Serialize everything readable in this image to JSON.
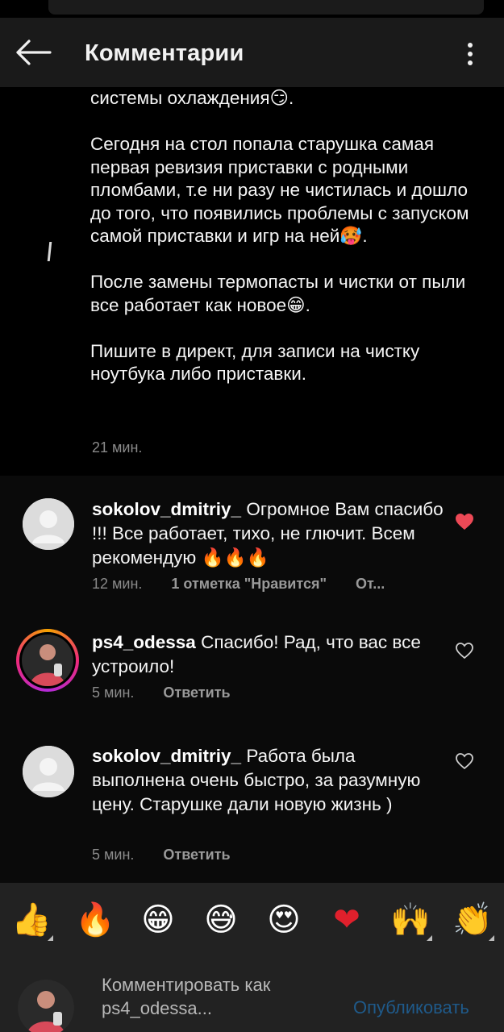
{
  "header": {
    "title": "Комментарии"
  },
  "post": {
    "text": "системы охлаждения😏.\n\n   Сегодня на стол попала старушка самая первая ревизия приставки с родными пломбами, т.е ни разу не чистилась и дошло до того, что появились проблемы с запуском самой приставки и игр на ней🥵.\n\n   После замены термопасты и чистки от пыли все работает как новое😁.\n\n   Пишите в директ, для записи на чистку ноутбука либо приставки.",
    "time": "21 мин."
  },
  "comments": [
    {
      "username": "sokolov_dmitriy_",
      "text": "Огромное Вам спасибо !!! Все работает, тихо, не глючит. Всем рекомендую 🔥🔥🔥",
      "time": "12 мин.",
      "likes": "1 отметка \"Нравится\"",
      "action": "От...",
      "liked": true,
      "avatar": "placeholder"
    },
    {
      "username": "ps4_odessa",
      "text": "Спасибо! Рад, что вас все устроило!",
      "time": "5 мин.",
      "action": "Ответить",
      "liked": false,
      "avatar": "photo"
    },
    {
      "username": "sokolov_dmitriy_",
      "text": "Работа была выполнена очень быстро, за разумную цену. Старушке дали новую жизнь )",
      "time": "5 мин.",
      "action": "Ответить",
      "liked": false,
      "avatar": "placeholder"
    }
  ],
  "emoji_bar": [
    "👍",
    "🔥",
    "😁",
    "😅",
    "😍",
    "❤",
    "🙌",
    "👏"
  ],
  "composer": {
    "placeholder": "Комментировать как ps4_odessa...",
    "publish_label": "Опубликовать"
  },
  "colors": {
    "background": "#000000",
    "header_bg": "#1a1a1a",
    "liked_heart": "#ed4956",
    "publish_disabled": "#1f5a8a"
  }
}
